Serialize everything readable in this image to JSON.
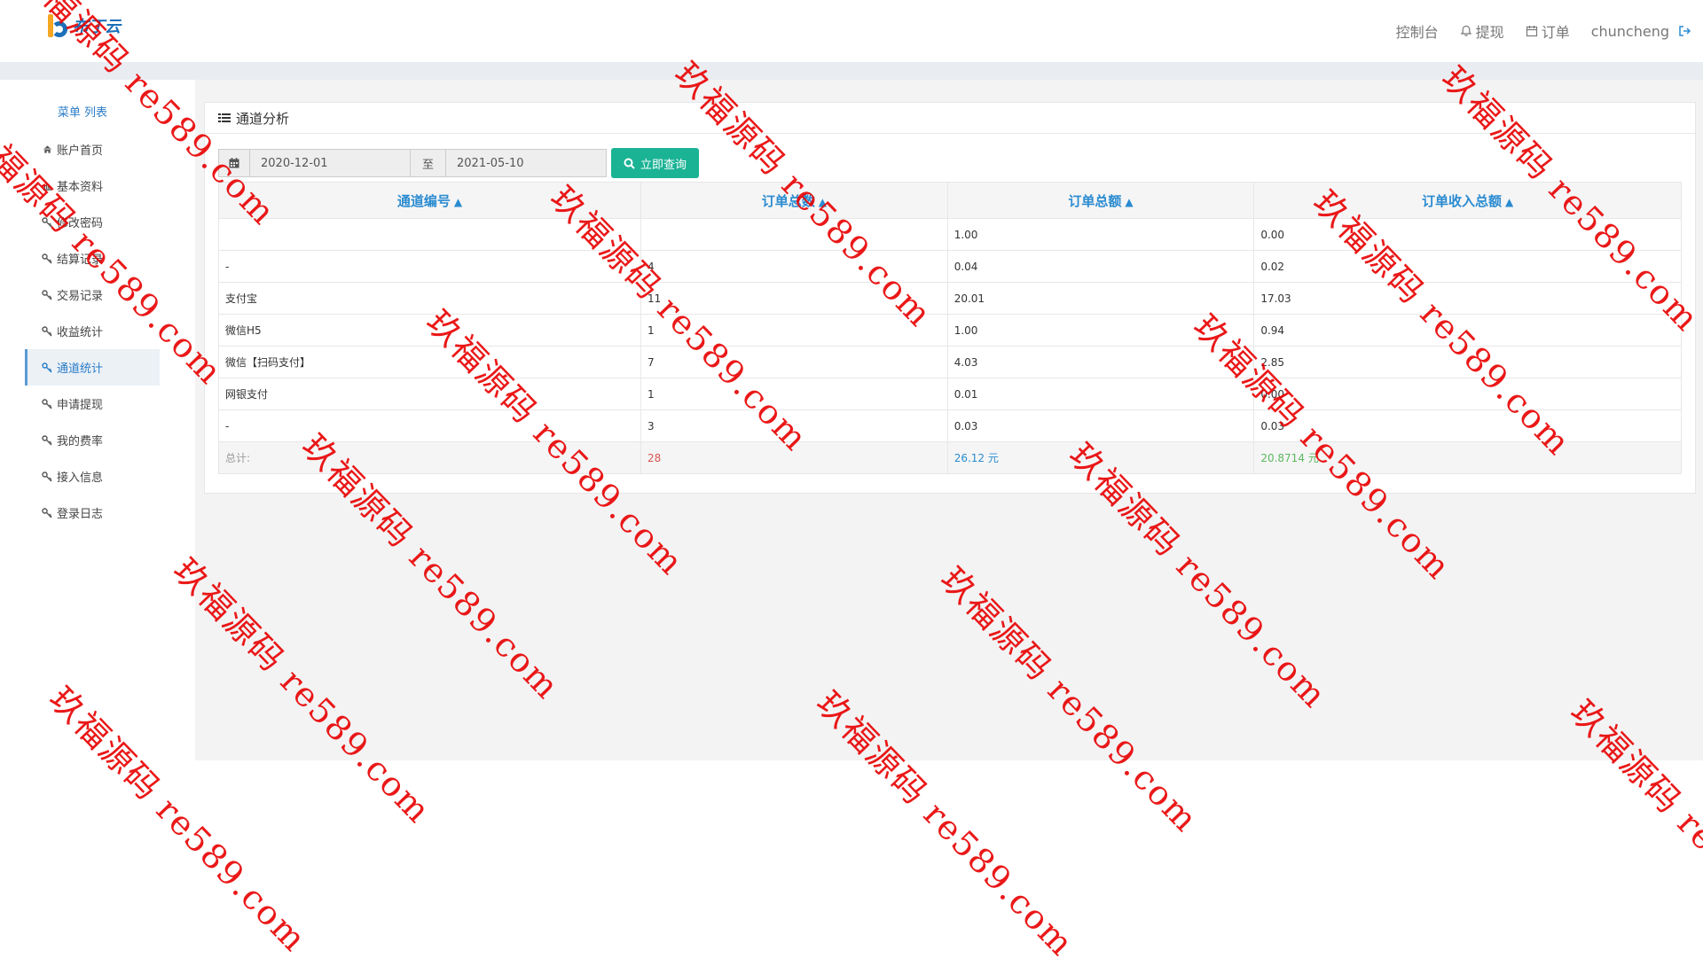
{
  "header": {
    "logo_text": "布丁云",
    "nav": [
      {
        "label": "控制台",
        "icon": ""
      },
      {
        "label": "提现",
        "icon": "bell-icon"
      },
      {
        "label": "订单",
        "icon": "calendar-icon"
      }
    ],
    "username": "chuncheng",
    "logout_icon": "sign-out-icon"
  },
  "sidebar": {
    "title": "菜单 列表",
    "items": [
      {
        "label": "账户首页",
        "icon": "home-icon"
      },
      {
        "label": "基本资料",
        "icon": "bar-chart-icon"
      },
      {
        "label": "修改密码",
        "icon": "key-icon"
      },
      {
        "label": "结算记录",
        "icon": "key-icon"
      },
      {
        "label": "交易记录",
        "icon": "key-icon"
      },
      {
        "label": "收益统计",
        "icon": "key-icon"
      },
      {
        "label": "通道统计",
        "icon": "key-icon",
        "active": true
      },
      {
        "label": "申请提现",
        "icon": "key-icon"
      },
      {
        "label": "我的费率",
        "icon": "key-icon"
      },
      {
        "label": "接入信息",
        "icon": "key-icon"
      },
      {
        "label": "登录日志",
        "icon": "key-icon"
      }
    ]
  },
  "panel": {
    "title": "通道分析",
    "date_from": "2020-12-01",
    "date_sep": "至",
    "date_to": "2021-05-10",
    "query_label": "立即查询"
  },
  "table": {
    "columns": [
      "通道编号",
      "订单总数",
      "订单总额",
      "订单收入总额"
    ],
    "rows": [
      [
        "",
        "",
        "1.00",
        "0.00"
      ],
      [
        "-",
        "4",
        "0.04",
        "0.02"
      ],
      [
        "支付宝",
        "11",
        "20.01",
        "17.03"
      ],
      [
        "微信H5",
        "1",
        "1.00",
        "0.94"
      ],
      [
        "微信【扫码支付】",
        "7",
        "4.03",
        "2.85"
      ],
      [
        "网银支付",
        "1",
        "0.01",
        "0.00"
      ],
      [
        "-",
        "3",
        "0.03",
        "0.03"
      ]
    ],
    "total": {
      "label": "总计:",
      "count": "28",
      "amount": "26.12 元",
      "income": "20.8714 元"
    }
  },
  "watermark_text": "玖福源码 re589.com",
  "colors": {
    "accent": "#2a8bd0",
    "button": "#1ab394",
    "watermark": "#e80000"
  }
}
